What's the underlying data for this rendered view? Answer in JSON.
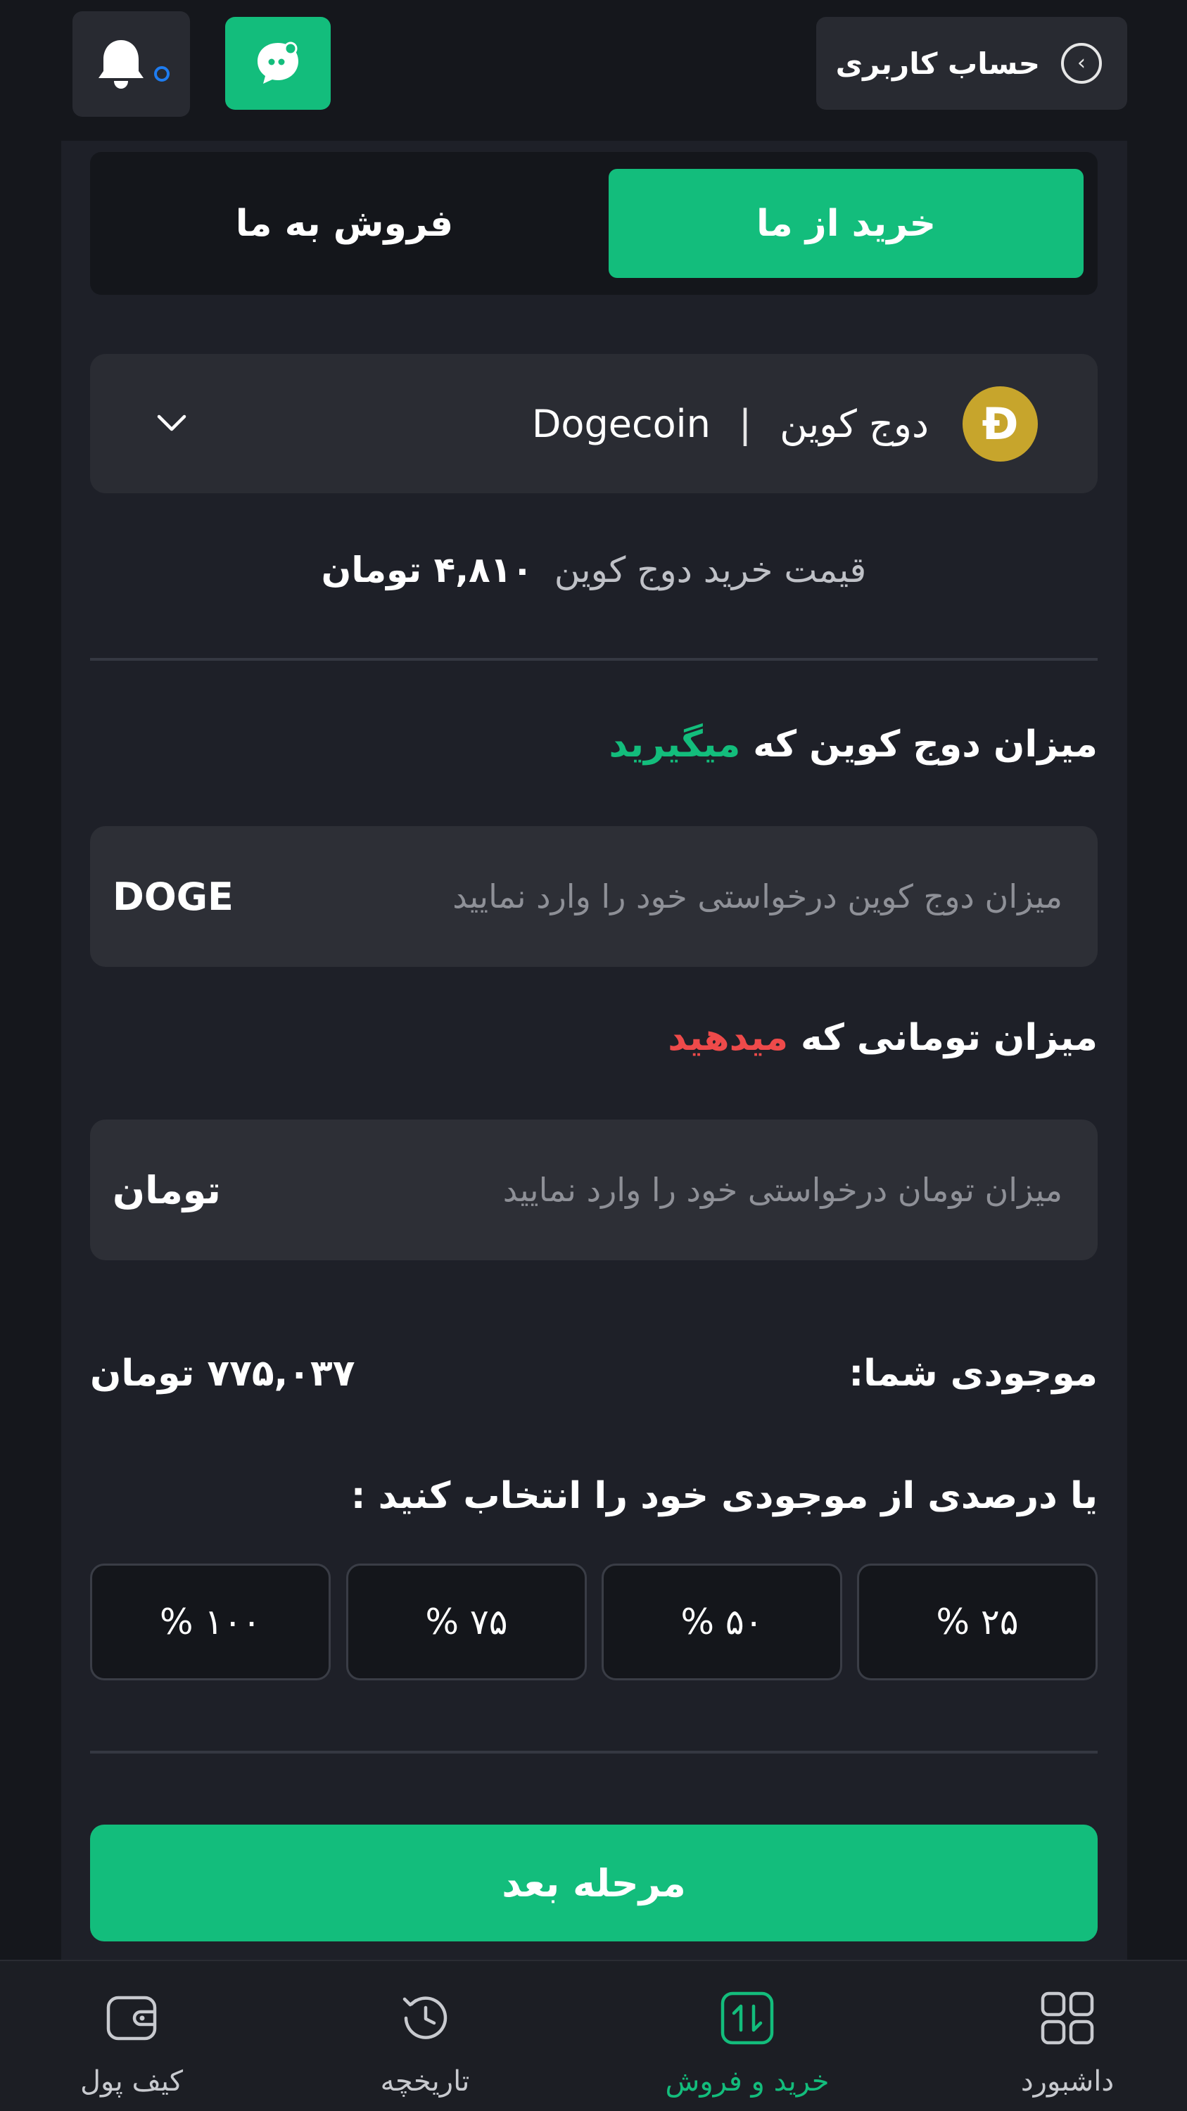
{
  "header": {
    "account_label": "حساب کاربری"
  },
  "tabs": {
    "buy_label": "خرید از ما",
    "sell_label": "فروش به ما"
  },
  "coin": {
    "name_fa": "دوج کوین",
    "separator": "|",
    "name_en": "Dogecoin",
    "logo_glyph": "Ð",
    "logo_color": "#c7a52c"
  },
  "price": {
    "label": "قیمت خرید دوج کوین",
    "value": "۴,۸۱۰ تومان"
  },
  "receive": {
    "label": "میزان دوج کوین که",
    "highlight": "میگیرید",
    "placeholder": "میزان دوج کوین درخواستی خود را وارد نمایید",
    "unit": "DOGE"
  },
  "pay": {
    "label": "میزان تومانی که",
    "highlight": "میدهید",
    "placeholder": "میزان تومان درخواستی خود را وارد نمایید",
    "unit": "تومان"
  },
  "balance": {
    "label": "موجودی شما:",
    "value": "۷۷۵,۰۳۷ تومان"
  },
  "percent": {
    "label": "یا درصدی از موجودی خود را انتخاب کنید :",
    "options": [
      "۲۵ %",
      "۵۰ %",
      "۷۵ %",
      "۱۰۰ %"
    ]
  },
  "next_button": "مرحله بعد",
  "bottom_nav": {
    "items": [
      {
        "label": "داشبورد",
        "icon": "grid-icon"
      },
      {
        "label": "خرید و فروش",
        "icon": "exchange-icon"
      },
      {
        "label": "تاریخچه",
        "icon": "history-icon"
      },
      {
        "label": "کیف پول",
        "icon": "wallet-icon"
      }
    ]
  },
  "colors": {
    "accent": "#13bd7c",
    "danger": "#ee4a4a",
    "background": "#15171c",
    "card": "#1e2028",
    "notification_dot": "#1e7cf0"
  }
}
